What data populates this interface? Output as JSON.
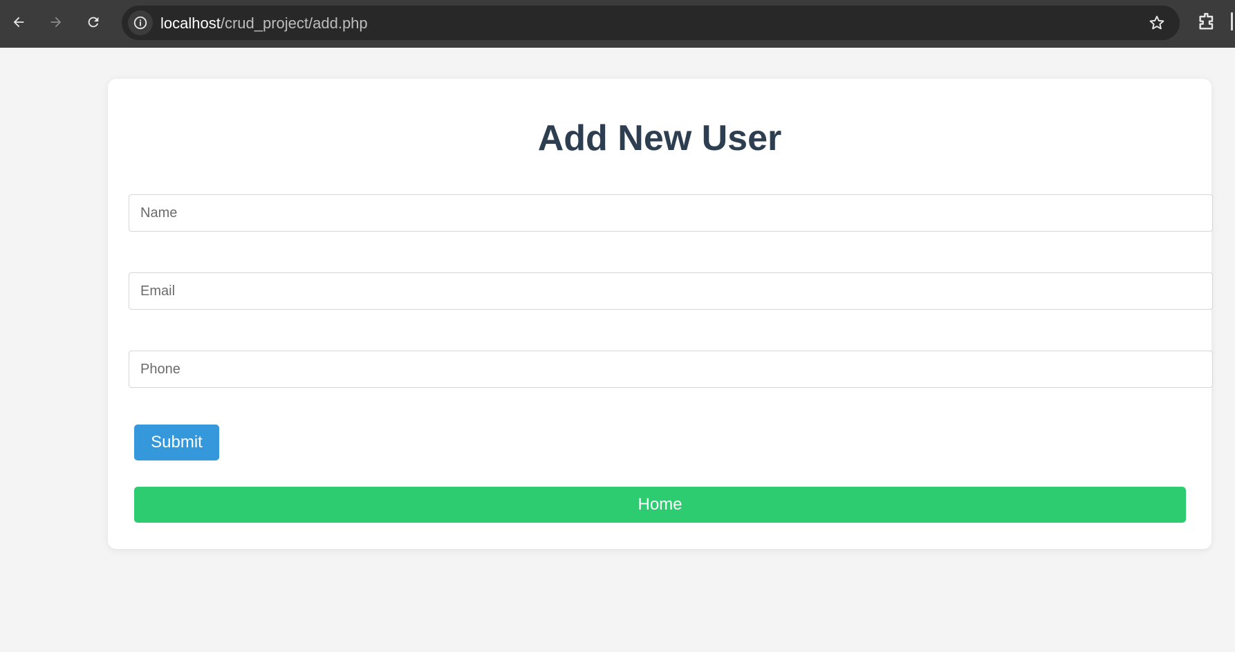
{
  "browser": {
    "url_host": "localhost",
    "url_path": "/crud_project/add.php"
  },
  "form": {
    "title": "Add New User",
    "name_placeholder": "Name",
    "email_placeholder": "Email",
    "phone_placeholder": "Phone",
    "submit_label": "Submit",
    "home_label": "Home"
  },
  "colors": {
    "title": "#2c3e50",
    "submit": "#3498db",
    "home": "#2ecc71"
  },
  "icons": [
    "back-arrow-icon",
    "forward-arrow-icon",
    "reload-icon",
    "info-icon",
    "star-icon",
    "extensions-icon"
  ]
}
